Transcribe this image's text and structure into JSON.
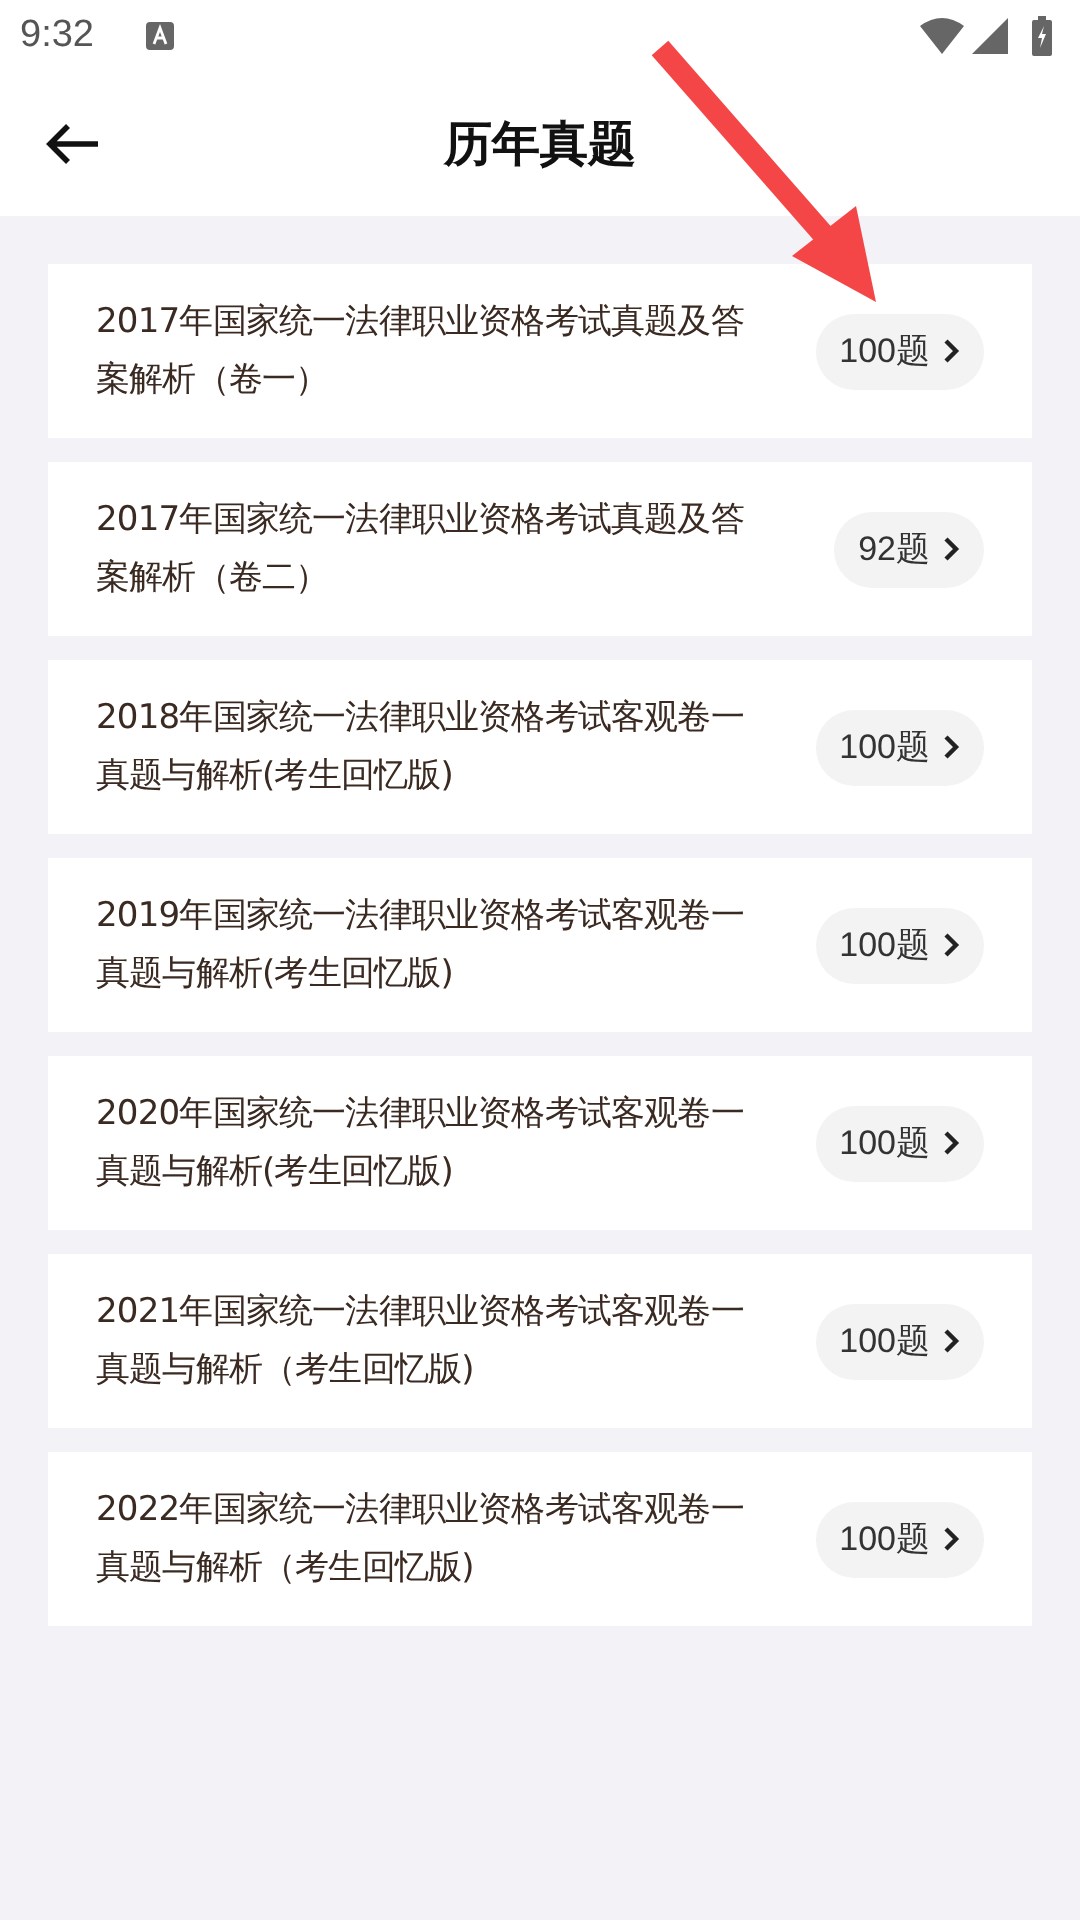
{
  "status_bar": {
    "time": "9:32"
  },
  "app_bar": {
    "title": "历年真题"
  },
  "papers": [
    {
      "title": "2017年国家统一法律职业资格考试真题及答案解析（卷一）",
      "count": "100题"
    },
    {
      "title": "2017年国家统一法律职业资格考试真题及答案解析（卷二）",
      "count": "92题"
    },
    {
      "title": "2018年国家统一法律职业资格考试客观卷一真题与解析(考生回忆版)",
      "count": "100题"
    },
    {
      "title": "2019年国家统一法律职业资格考试客观卷一真题与解析(考生回忆版)",
      "count": "100题"
    },
    {
      "title": "2020年国家统一法律职业资格考试客观卷一真题与解析(考生回忆版)",
      "count": "100题"
    },
    {
      "title": "2021年国家统一法律职业资格考试客观卷一真题与解析（考生回忆版)",
      "count": "100题"
    },
    {
      "title": "2022年国家统一法律职业资格考试客观卷一真题与解析（考生回忆版)",
      "count": "100题"
    }
  ],
  "annotation": {
    "kind": "arrow"
  }
}
